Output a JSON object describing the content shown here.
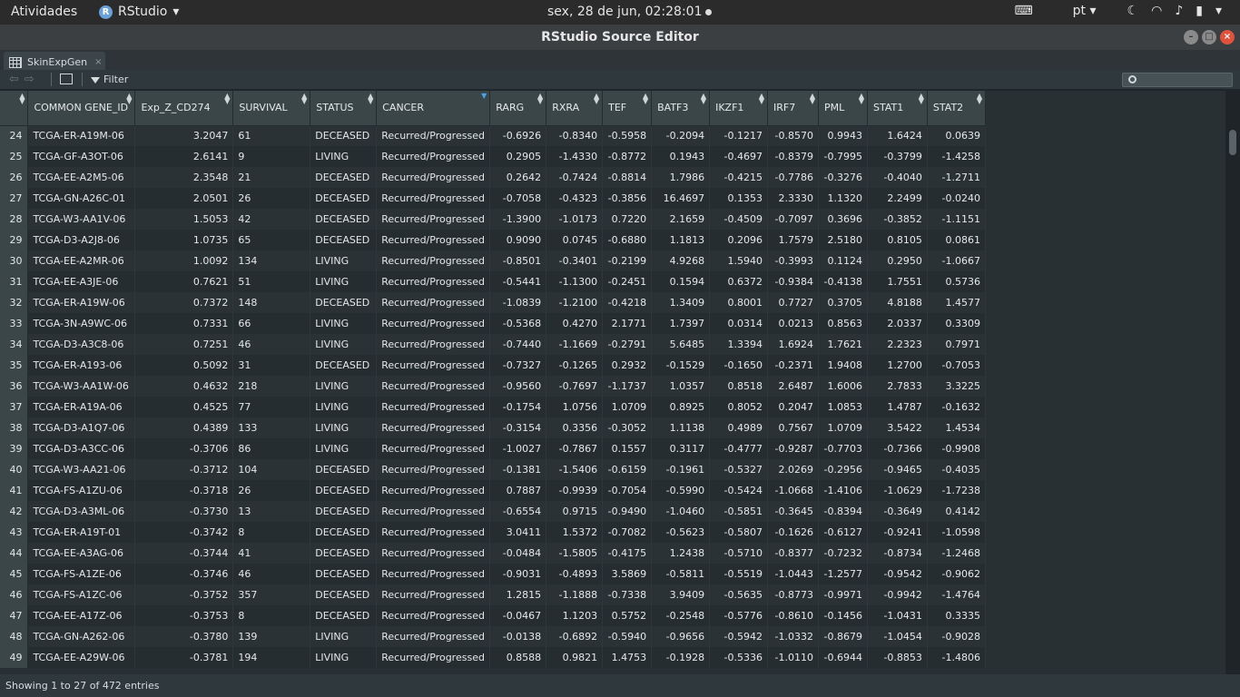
{
  "topbar": {
    "activities": "Atividades",
    "app_name": "RStudio",
    "clock": "sex, 28 de jun, 02:28:01",
    "lang": "pt"
  },
  "window": {
    "title": "RStudio Source Editor"
  },
  "tab": {
    "label": "SkinExpGen",
    "close": "×"
  },
  "toolbar": {
    "filter_label": "Filter",
    "search_placeholder": ""
  },
  "columns": [
    "COMMON GENE_ID",
    "Exp_Z_CD274",
    "SURVIVAL",
    "STATUS",
    "CANCER",
    "RARG",
    "RXRA",
    "TEF",
    "BATF3",
    "IKZF1",
    "IRF7",
    "PML",
    "STAT1",
    "STAT2"
  ],
  "rows": [
    [
      "24",
      "TCGA-ER-A19M-06",
      "3.2047",
      "61",
      "DECEASED",
      "Recurred/Progressed",
      "-0.6926",
      "-0.8340",
      "-0.5958",
      "-0.2094",
      "-0.1217",
      "-0.8570",
      "0.9943",
      "1.6424",
      "0.0639"
    ],
    [
      "25",
      "TCGA-GF-A3OT-06",
      "2.6141",
      "9",
      "LIVING",
      "Recurred/Progressed",
      "0.2905",
      "-1.4330",
      "-0.8772",
      "0.1943",
      "-0.4697",
      "-0.8379",
      "-0.7995",
      "-0.3799",
      "-1.4258"
    ],
    [
      "26",
      "TCGA-EE-A2M5-06",
      "2.3548",
      "21",
      "DECEASED",
      "Recurred/Progressed",
      "0.2642",
      "-0.7424",
      "-0.8814",
      "1.7986",
      "-0.4215",
      "-0.7786",
      "-0.3276",
      "-0.4040",
      "-1.2711"
    ],
    [
      "27",
      "TCGA-GN-A26C-01",
      "2.0501",
      "26",
      "DECEASED",
      "Recurred/Progressed",
      "-0.7058",
      "-0.4323",
      "-0.3856",
      "16.4697",
      "0.1353",
      "2.3330",
      "1.1320",
      "2.2499",
      "-0.0240"
    ],
    [
      "28",
      "TCGA-W3-AA1V-06",
      "1.5053",
      "42",
      "DECEASED",
      "Recurred/Progressed",
      "-1.3900",
      "-1.0173",
      "0.7220",
      "2.1659",
      "-0.4509",
      "-0.7097",
      "0.3696",
      "-0.3852",
      "-1.1151"
    ],
    [
      "29",
      "TCGA-D3-A2J8-06",
      "1.0735",
      "65",
      "DECEASED",
      "Recurred/Progressed",
      "0.9090",
      "0.0745",
      "-0.6880",
      "1.1813",
      "0.2096",
      "1.7579",
      "2.5180",
      "0.8105",
      "0.0861"
    ],
    [
      "30",
      "TCGA-EE-A2MR-06",
      "1.0092",
      "134",
      "LIVING",
      "Recurred/Progressed",
      "-0.8501",
      "-0.3401",
      "-0.2199",
      "4.9268",
      "1.5940",
      "-0.3993",
      "0.1124",
      "0.2950",
      "-1.0667"
    ],
    [
      "31",
      "TCGA-EE-A3JE-06",
      "0.7621",
      "51",
      "LIVING",
      "Recurred/Progressed",
      "-0.5441",
      "-1.1300",
      "-0.2451",
      "0.1594",
      "0.6372",
      "-0.9384",
      "-0.4138",
      "1.7551",
      "0.5736"
    ],
    [
      "32",
      "TCGA-ER-A19W-06",
      "0.7372",
      "148",
      "DECEASED",
      "Recurred/Progressed",
      "-1.0839",
      "-1.2100",
      "-0.4218",
      "1.3409",
      "0.8001",
      "0.7727",
      "0.3705",
      "4.8188",
      "1.4577"
    ],
    [
      "33",
      "TCGA-3N-A9WC-06",
      "0.7331",
      "66",
      "LIVING",
      "Recurred/Progressed",
      "-0.5368",
      "0.4270",
      "2.1771",
      "1.7397",
      "0.0314",
      "0.0213",
      "0.8563",
      "2.0337",
      "0.3309"
    ],
    [
      "34",
      "TCGA-D3-A3C8-06",
      "0.7251",
      "46",
      "LIVING",
      "Recurred/Progressed",
      "-0.7440",
      "-1.1669",
      "-0.2791",
      "5.6485",
      "1.3394",
      "1.6924",
      "1.7621",
      "2.2323",
      "0.7971"
    ],
    [
      "35",
      "TCGA-ER-A193-06",
      "0.5092",
      "31",
      "DECEASED",
      "Recurred/Progressed",
      "-0.7327",
      "-0.1265",
      "0.2932",
      "-0.1529",
      "-0.1650",
      "-0.2371",
      "1.9408",
      "1.2700",
      "-0.7053"
    ],
    [
      "36",
      "TCGA-W3-AA1W-06",
      "0.4632",
      "218",
      "LIVING",
      "Recurred/Progressed",
      "-0.9560",
      "-0.7697",
      "-1.1737",
      "1.0357",
      "0.8518",
      "2.6487",
      "1.6006",
      "2.7833",
      "3.3225"
    ],
    [
      "37",
      "TCGA-ER-A19A-06",
      "0.4525",
      "77",
      "LIVING",
      "Recurred/Progressed",
      "-0.1754",
      "1.0756",
      "1.0709",
      "0.8925",
      "0.8052",
      "0.2047",
      "1.0853",
      "1.4787",
      "-0.1632"
    ],
    [
      "38",
      "TCGA-D3-A1Q7-06",
      "0.4389",
      "133",
      "LIVING",
      "Recurred/Progressed",
      "-0.3154",
      "0.3356",
      "-0.3052",
      "1.1138",
      "0.4989",
      "0.7567",
      "1.0709",
      "3.5422",
      "1.4534"
    ],
    [
      "39",
      "TCGA-D3-A3CC-06",
      "-0.3706",
      "86",
      "LIVING",
      "Recurred/Progressed",
      "-1.0027",
      "-0.7867",
      "0.1557",
      "0.3117",
      "-0.4777",
      "-0.9287",
      "-0.7703",
      "-0.7366",
      "-0.9908"
    ],
    [
      "40",
      "TCGA-W3-AA21-06",
      "-0.3712",
      "104",
      "DECEASED",
      "Recurred/Progressed",
      "-0.1381",
      "-1.5406",
      "-0.6159",
      "-0.1961",
      "-0.5327",
      "2.0269",
      "-0.2956",
      "-0.9465",
      "-0.4035"
    ],
    [
      "41",
      "TCGA-FS-A1ZU-06",
      "-0.3718",
      "26",
      "DECEASED",
      "Recurred/Progressed",
      "0.7887",
      "-0.9939",
      "-0.7054",
      "-0.5990",
      "-0.5424",
      "-1.0668",
      "-1.4106",
      "-1.0629",
      "-1.7238"
    ],
    [
      "42",
      "TCGA-D3-A3ML-06",
      "-0.3730",
      "13",
      "DECEASED",
      "Recurred/Progressed",
      "-0.6554",
      "0.9715",
      "-0.9490",
      "-1.0460",
      "-0.5851",
      "-0.3645",
      "-0.8394",
      "-0.3649",
      "0.4142"
    ],
    [
      "43",
      "TCGA-ER-A19T-01",
      "-0.3742",
      "8",
      "DECEASED",
      "Recurred/Progressed",
      "3.0411",
      "1.5372",
      "-0.7082",
      "-0.5623",
      "-0.5807",
      "-0.1626",
      "-0.6127",
      "-0.9241",
      "-1.0598"
    ],
    [
      "44",
      "TCGA-EE-A3AG-06",
      "-0.3744",
      "41",
      "DECEASED",
      "Recurred/Progressed",
      "-0.0484",
      "-1.5805",
      "-0.4175",
      "1.2438",
      "-0.5710",
      "-0.8377",
      "-0.7232",
      "-0.8734",
      "-1.2468"
    ],
    [
      "45",
      "TCGA-FS-A1ZE-06",
      "-0.3746",
      "46",
      "DECEASED",
      "Recurred/Progressed",
      "-0.9031",
      "-0.4893",
      "3.5869",
      "-0.5811",
      "-0.5519",
      "-1.0443",
      "-1.2577",
      "-0.9542",
      "-0.9062"
    ],
    [
      "46",
      "TCGA-FS-A1ZC-06",
      "-0.3752",
      "357",
      "DECEASED",
      "Recurred/Progressed",
      "1.2815",
      "-1.1888",
      "-0.7338",
      "3.9409",
      "-0.5635",
      "-0.8773",
      "-0.9971",
      "-0.9942",
      "-1.4764"
    ],
    [
      "47",
      "TCGA-EE-A17Z-06",
      "-0.3753",
      "8",
      "DECEASED",
      "Recurred/Progressed",
      "-0.0467",
      "1.1203",
      "0.5752",
      "-0.2548",
      "-0.5776",
      "-0.8610",
      "-0.1456",
      "-1.0431",
      "0.3335"
    ],
    [
      "48",
      "TCGA-GN-A262-06",
      "-0.3780",
      "139",
      "LIVING",
      "Recurred/Progressed",
      "-0.0138",
      "-0.6892",
      "-0.5940",
      "-0.9656",
      "-0.5942",
      "-1.0332",
      "-0.8679",
      "-1.0454",
      "-0.9028"
    ],
    [
      "49",
      "TCGA-EE-A29W-06",
      "-0.3781",
      "194",
      "LIVING",
      "Recurred/Progressed",
      "0.8588",
      "0.9821",
      "1.4753",
      "-0.1928",
      "-0.5336",
      "-1.0110",
      "-0.6944",
      "-0.8853",
      "-1.4806"
    ]
  ],
  "status": {
    "text": "Showing 1 to 27 of 472 entries"
  }
}
